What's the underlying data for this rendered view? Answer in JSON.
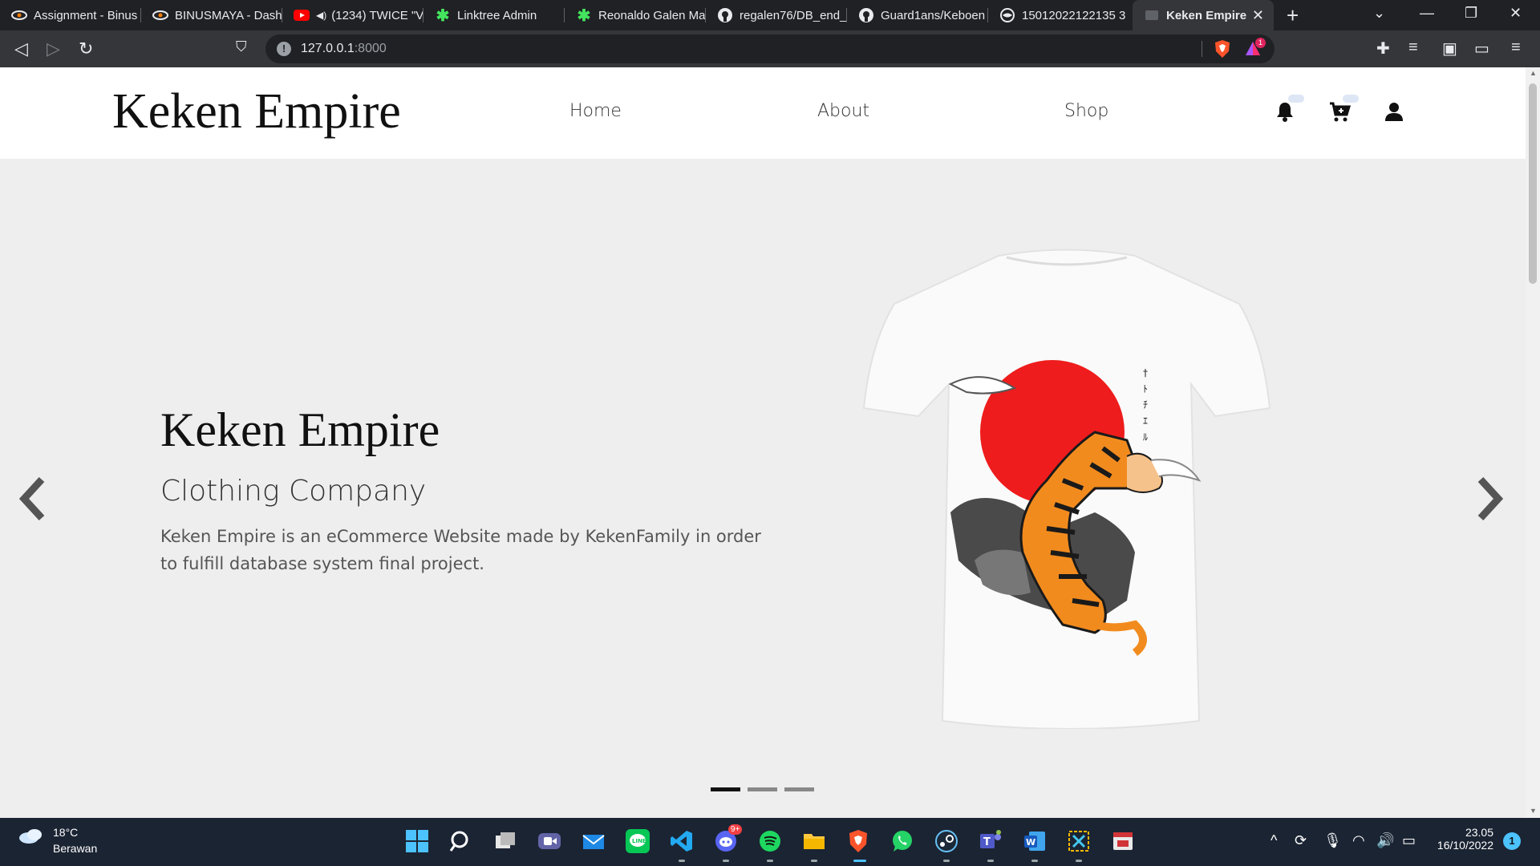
{
  "browser": {
    "tabs": [
      {
        "title": "Assignment - Binus",
        "icon": "binus-icon"
      },
      {
        "title": "BINUSMAYA - Dash",
        "icon": "binus-icon"
      },
      {
        "title": "(1234) TWICE \"V",
        "icon": "youtube-icon"
      },
      {
        "title": "Linktree Admin",
        "icon": "linktree-icon"
      },
      {
        "title": "Reonaldo Galen Ma",
        "icon": "linktree-icon"
      },
      {
        "title": "regalen76/DB_end_",
        "icon": "github-icon"
      },
      {
        "title": "Guard1ans/Keboen",
        "icon": "github-icon"
      },
      {
        "title": "15012022122135 3",
        "icon": "globe-icon"
      },
      {
        "title": "Keken Empire",
        "icon": "page-icon"
      }
    ],
    "url_host": "127.0.0.1",
    "url_port": ":8000",
    "brave_badge": "1"
  },
  "site": {
    "brand": "Keken Empire",
    "nav": [
      "Home",
      "About",
      "Shop"
    ],
    "hero": {
      "title": "Keken Empire",
      "subtitle": "Clothing Company",
      "description": "Keken Empire is an eCommerce Website made by KekenFamily in order to fulfill database system final project."
    },
    "carousel_active_index": 0,
    "carousel_slide_count": 3
  },
  "taskbar": {
    "weather_temp": "18°C",
    "weather_desc": "Berawan",
    "time": "23.05",
    "date": "16/10/2022",
    "discord_badge": "9+",
    "notification_count": "1"
  }
}
